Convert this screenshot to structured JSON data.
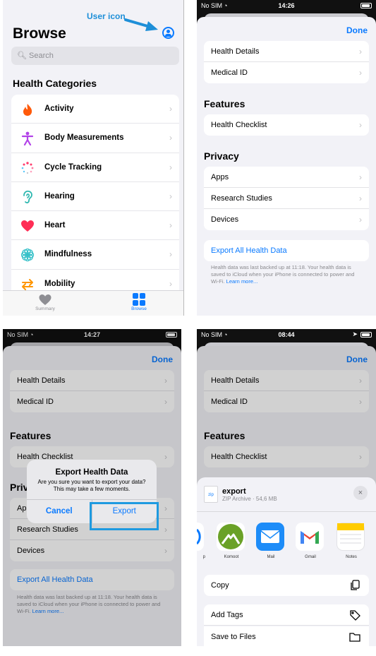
{
  "panel1": {
    "annotation": "User icon",
    "title": "Browse",
    "search_placeholder": "Search",
    "section_title": "Health Categories",
    "categories": [
      {
        "label": "Activity",
        "icon": "flame-icon"
      },
      {
        "label": "Body Measurements",
        "icon": "person-figure-icon"
      },
      {
        "label": "Cycle Tracking",
        "icon": "cycle-dots-icon"
      },
      {
        "label": "Hearing",
        "icon": "ear-icon"
      },
      {
        "label": "Heart",
        "icon": "heart-icon"
      },
      {
        "label": "Mindfulness",
        "icon": "flower-icon"
      },
      {
        "label": "Mobility",
        "icon": "arrows-icon"
      }
    ],
    "tabs": [
      {
        "label": "Summary",
        "icon": "heart-icon"
      },
      {
        "label": "Browse",
        "icon": "grid-icon"
      }
    ]
  },
  "panel2": {
    "status": {
      "carrier": "No SIM",
      "time": "14:26"
    },
    "done": "Done",
    "top_rows": [
      "Health Details",
      "Medical ID"
    ],
    "features_title": "Features",
    "features_rows": [
      "Health Checklist"
    ],
    "privacy_title": "Privacy",
    "privacy_rows": [
      "Apps",
      "Research Studies",
      "Devices"
    ],
    "export_label": "Export All Health Data",
    "footnote": "Health data was last backed up at 11:18. Your health data is saved to iCloud when your iPhone is connected to power and Wi-Fi.",
    "learn_more": "Learn more..."
  },
  "panel3": {
    "status": {
      "carrier": "No SIM",
      "time": "14:27"
    },
    "done": "Done",
    "top_rows": [
      "Health Details",
      "Medical ID"
    ],
    "features_title": "Features",
    "features_rows": [
      "Health Checklist"
    ],
    "privacy_title": "Privacy",
    "privacy_rows": [
      "Apps",
      "Research Studies",
      "Devices"
    ],
    "export_label": "Export All Health Data",
    "footnote": "Health data was last backed up at 11:18. Your health data is saved to iCloud when your iPhone is connected to power and Wi-Fi.",
    "learn_more": "Learn more...",
    "alert": {
      "title": "Export Health Data",
      "message": "Are you sure you want to export your data? This may take a few moments.",
      "cancel": "Cancel",
      "confirm": "Export"
    }
  },
  "panel4": {
    "status": {
      "carrier": "No SIM",
      "time": "08:44"
    },
    "done": "Done",
    "top_rows": [
      "Health Details",
      "Medical ID"
    ],
    "features_title": "Features",
    "features_rows": [
      "Health Checklist"
    ],
    "file": {
      "badge": "zip",
      "name": "export",
      "subtitle": "ZIP Archive · 54,6 MB"
    },
    "close": "×",
    "apps": [
      {
        "label": "p",
        "icon": "partial-app-icon"
      },
      {
        "label": "Komoot",
        "icon": "komoot-icon"
      },
      {
        "label": "Mail",
        "icon": "mail-icon"
      },
      {
        "label": "Gmail",
        "icon": "gmail-icon"
      },
      {
        "label": "Notes",
        "icon": "notes-icon"
      }
    ],
    "actions": [
      {
        "label": "Copy",
        "icon": "copy-icon"
      },
      {
        "label": "Add Tags",
        "icon": "tag-icon"
      },
      {
        "label": "Save to Files",
        "icon": "folder-icon"
      }
    ]
  },
  "colors": {
    "accent": "#0a7aff",
    "annotation": "#1e8fd8",
    "background": "#f2f2f7"
  }
}
